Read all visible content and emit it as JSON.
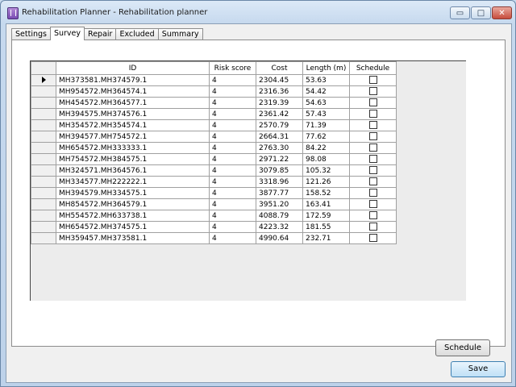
{
  "window": {
    "title": "Rehabilitation Planner - Rehabilitation planner",
    "min_glyph": "▭",
    "max_glyph": "□",
    "close_glyph": "✕"
  },
  "tabs": [
    "Settings",
    "Survey",
    "Repair",
    "Excluded",
    "Summary"
  ],
  "active_tab": "Survey",
  "grid": {
    "columns": [
      "ID",
      "Risk score",
      "Cost",
      "Length (m)",
      "Schedule"
    ],
    "rows": [
      {
        "id": "MH373581.MH374579.1",
        "risk": "4",
        "cost": "2304.45",
        "length": "53.63",
        "schedule": false
      },
      {
        "id": "MH954572.MH364574.1",
        "risk": "4",
        "cost": "2316.36",
        "length": "54.42",
        "schedule": false
      },
      {
        "id": "MH454572.MH364577.1",
        "risk": "4",
        "cost": "2319.39",
        "length": "54.63",
        "schedule": false
      },
      {
        "id": "MH394575.MH374576.1",
        "risk": "4",
        "cost": "2361.42",
        "length": "57.43",
        "schedule": false
      },
      {
        "id": "MH354572.MH354574.1",
        "risk": "4",
        "cost": "2570.79",
        "length": "71.39",
        "schedule": false
      },
      {
        "id": "MH394577.MH754572.1",
        "risk": "4",
        "cost": "2664.31",
        "length": "77.62",
        "schedule": false
      },
      {
        "id": "MH654572.MH333333.1",
        "risk": "4",
        "cost": "2763.30",
        "length": "84.22",
        "schedule": false
      },
      {
        "id": "MH754572.MH384575.1",
        "risk": "4",
        "cost": "2971.22",
        "length": "98.08",
        "schedule": false
      },
      {
        "id": "MH324571.MH364576.1",
        "risk": "4",
        "cost": "3079.85",
        "length": "105.32",
        "schedule": false
      },
      {
        "id": "MH334577.MH222222.1",
        "risk": "4",
        "cost": "3318.96",
        "length": "121.26",
        "schedule": false
      },
      {
        "id": "MH394579.MH334575.1",
        "risk": "4",
        "cost": "3877.77",
        "length": "158.52",
        "schedule": false
      },
      {
        "id": "MH854572.MH364579.1",
        "risk": "4",
        "cost": "3951.20",
        "length": "163.41",
        "schedule": false
      },
      {
        "id": "MH554572.MH633738.1",
        "risk": "4",
        "cost": "4088.79",
        "length": "172.59",
        "schedule": false
      },
      {
        "id": "MH654572.MH374575.1",
        "risk": "4",
        "cost": "4223.32",
        "length": "181.55",
        "schedule": false
      },
      {
        "id": "MH359457.MH373581.1",
        "risk": "4",
        "cost": "4990.64",
        "length": "232.71",
        "schedule": false
      }
    ]
  },
  "buttons": {
    "schedule": "Schedule",
    "save": "Save"
  }
}
